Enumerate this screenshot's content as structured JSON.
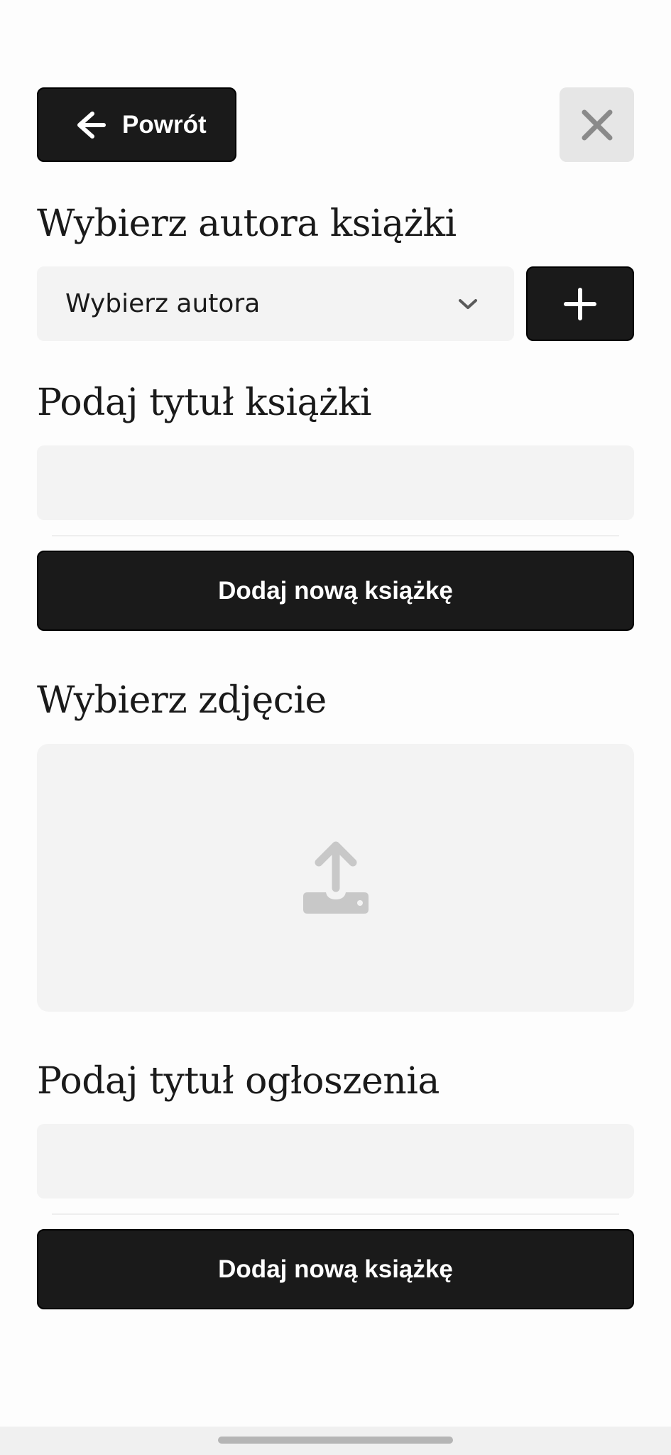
{
  "header": {
    "back_label": "Powrót",
    "back_icon": "arrow-left-icon",
    "close_icon": "close-icon"
  },
  "author_section": {
    "title": "Wybierz autora książki",
    "select_value": "Wybierz autora",
    "select_icon": "chevron-down-icon",
    "add_icon": "plus-icon"
  },
  "book_title_section": {
    "title": "Podaj tytuł książki",
    "input_value": "",
    "input_placeholder": "",
    "submit_label": "Dodaj nową książkę"
  },
  "photo_section": {
    "title": "Wybierz zdjęcie",
    "upload_icon": "upload-icon"
  },
  "listing_title_section": {
    "title": "Podaj tytuł ogłoszenia",
    "input_value": "",
    "input_placeholder": "",
    "submit_label": "Dodaj nową książkę"
  },
  "colors": {
    "primary": "#1a1a1a",
    "field_bg": "#f3f3f3",
    "close_bg": "#e6e6e6",
    "icon_muted": "#8a8a8a",
    "upload_icon": "#c8c8c8"
  }
}
